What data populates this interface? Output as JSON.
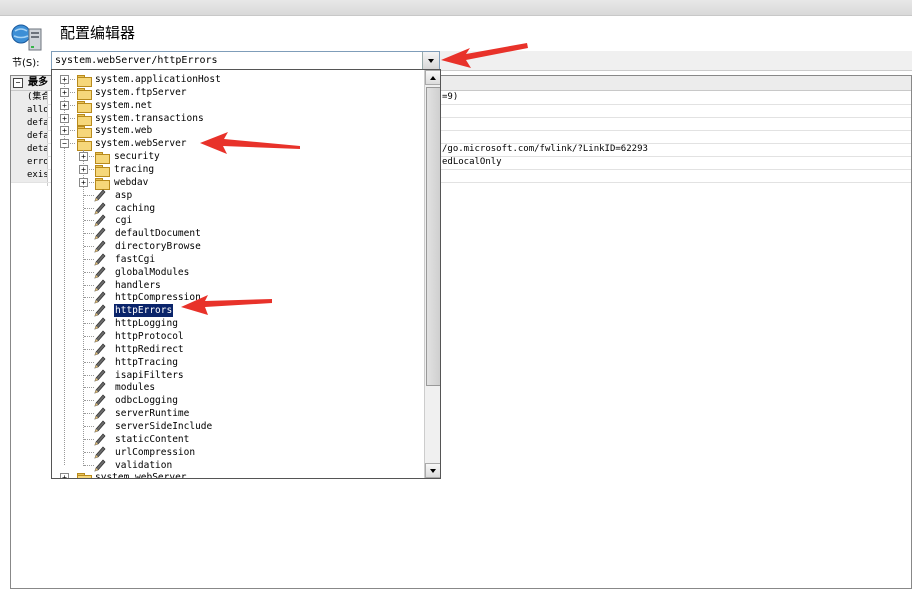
{
  "window": {
    "title": "配置编辑器"
  },
  "section": {
    "label": "节(S):",
    "value": "system.webServer/httpErrors"
  },
  "grid": {
    "header": "最多",
    "rows": [
      {
        "name": "(集合",
        "value": "=9)"
      },
      {
        "name": "allo",
        "value": ""
      },
      {
        "name": "defa",
        "value": ""
      },
      {
        "name": "defa",
        "value": ""
      },
      {
        "name": "deta",
        "value": "/go.microsoft.com/fwlink/?LinkID=62293"
      },
      {
        "name": "erro",
        "value": "edLocalOnly"
      },
      {
        "name": "exis",
        "value": ""
      }
    ]
  },
  "tree": {
    "roots": [
      {
        "label": "system.applicationHost",
        "expander": "+"
      },
      {
        "label": "system.ftpServer",
        "expander": "+"
      },
      {
        "label": "system.net",
        "expander": "+"
      },
      {
        "label": "system.transactions",
        "expander": "+"
      },
      {
        "label": "system.web",
        "expander": "+"
      },
      {
        "label": "system.webServer",
        "expander": "−"
      }
    ],
    "child_folders": [
      {
        "label": "security",
        "expander": "+"
      },
      {
        "label": "tracing",
        "expander": "+"
      },
      {
        "label": "webdav",
        "expander": "+"
      }
    ],
    "child_sections": [
      "asp",
      "caching",
      "cgi",
      "defaultDocument",
      "directoryBrowse",
      "fastCgi",
      "globalModules",
      "handlers",
      "httpCompression",
      "httpErrors",
      "httpLogging",
      "httpProtocol",
      "httpRedirect",
      "httpTracing",
      "isapiFilters",
      "modules",
      "odbcLogging",
      "serverRuntime",
      "serverSideInclude",
      "staticContent",
      "urlCompression",
      "validation"
    ],
    "selected": "httpErrors",
    "next_root_partial": "system.webServer..."
  },
  "colors": {
    "selection": "#0a246a",
    "arrow": "#e8322a",
    "folder": "#f6d77a"
  },
  "icons": {
    "app": "server-icon",
    "folder": "folder-icon",
    "section": "pen-icon"
  }
}
